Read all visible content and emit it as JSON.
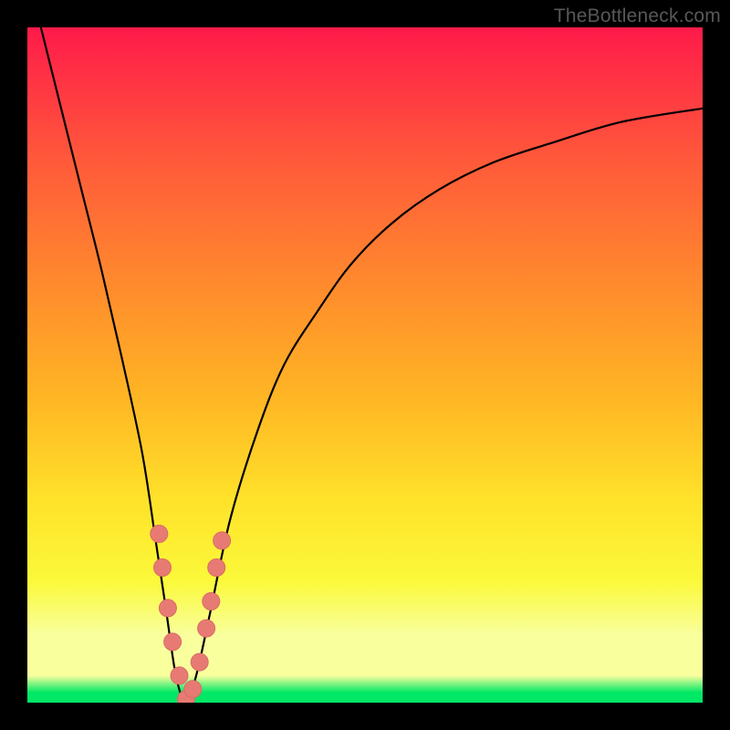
{
  "watermark": "TheBottleneck.com",
  "colors": {
    "black": "#000000",
    "curve": "#000000",
    "marker_fill": "#e77b74",
    "marker_stroke": "#d96c65",
    "grad_top": "#ff1a4a",
    "grad_1": "#ff5a3a",
    "grad_2": "#ff8a2d",
    "grad_3": "#ffb624",
    "grad_4": "#ffe22a",
    "grad_5": "#fbf93a",
    "grad_band": "#f9ff9d",
    "grad_green": "#00e865"
  },
  "chart_data": {
    "type": "line",
    "title": "",
    "xlabel": "",
    "ylabel": "",
    "xlim": [
      0,
      100
    ],
    "ylim": [
      0,
      100
    ],
    "series": [
      {
        "name": "bottleneck-curve",
        "x": [
          2,
          5,
          8,
          11,
          14,
          17,
          19,
          20.5,
          22,
          23.5,
          25,
          27,
          30,
          34,
          38,
          43,
          48,
          54,
          61,
          69,
          78,
          88,
          100
        ],
        "y": [
          100,
          88,
          76,
          64,
          51,
          37,
          24,
          14,
          4,
          0,
          4,
          13,
          27,
          40,
          50,
          58,
          65,
          71,
          76,
          80,
          83,
          86,
          88
        ]
      }
    ],
    "markers": {
      "name": "highlighted-points",
      "points": [
        {
          "x": 19.5,
          "y": 25
        },
        {
          "x": 20.0,
          "y": 20
        },
        {
          "x": 20.8,
          "y": 14
        },
        {
          "x": 21.5,
          "y": 9
        },
        {
          "x": 22.5,
          "y": 4
        },
        {
          "x": 23.5,
          "y": 0.5
        },
        {
          "x": 24.5,
          "y": 2
        },
        {
          "x": 25.5,
          "y": 6
        },
        {
          "x": 26.5,
          "y": 11
        },
        {
          "x": 27.2,
          "y": 15
        },
        {
          "x": 28.0,
          "y": 20
        },
        {
          "x": 28.8,
          "y": 24
        }
      ]
    }
  }
}
